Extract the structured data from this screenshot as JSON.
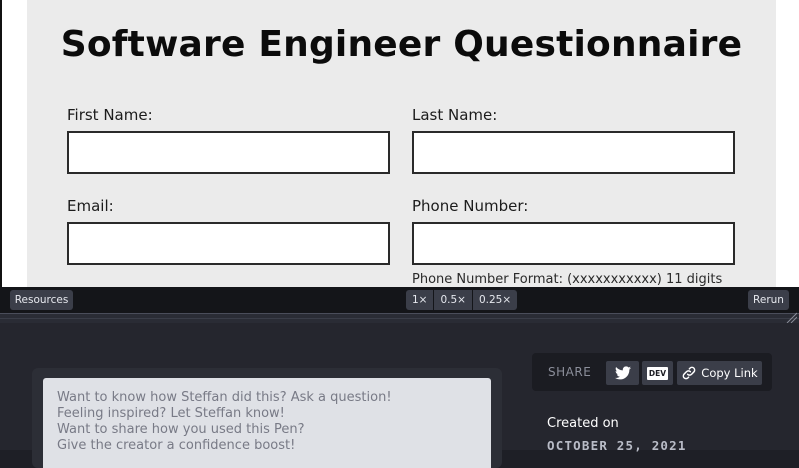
{
  "form": {
    "title": "Software Engineer Questionnaire",
    "fields": {
      "first_name": {
        "label": "First Name:",
        "value": ""
      },
      "last_name": {
        "label": "Last Name:",
        "value": ""
      },
      "email": {
        "label": "Email:",
        "value": ""
      },
      "phone": {
        "label": "Phone Number:",
        "value": "",
        "hint": "Phone Number Format: (xxxxxxxxxxx) 11 digits"
      }
    }
  },
  "toolbar": {
    "resources_label": "Resources",
    "zoom_options": [
      "1×",
      "0.5×",
      "0.25×"
    ],
    "rerun_label": "Rerun"
  },
  "comments": {
    "lines": [
      "Want to know how Steffan did this? Ask a question!",
      "Feeling inspired? Let Steffan know!",
      "Want to share how you used this Pen?",
      "Give the creator a confidence boost!"
    ]
  },
  "share": {
    "label": "SHARE",
    "twitter_icon": "twitter-bird-icon",
    "dev_label": "DEV",
    "copy_label": "Copy Link"
  },
  "meta": {
    "created_label": "Created on",
    "created_date": "OCTOBER 25, 2021"
  },
  "colors": {
    "form_bg": "#ebebeb",
    "toolbar_bg": "#141519",
    "button_bg": "#3b3e49",
    "details_bg": "#25262e"
  }
}
